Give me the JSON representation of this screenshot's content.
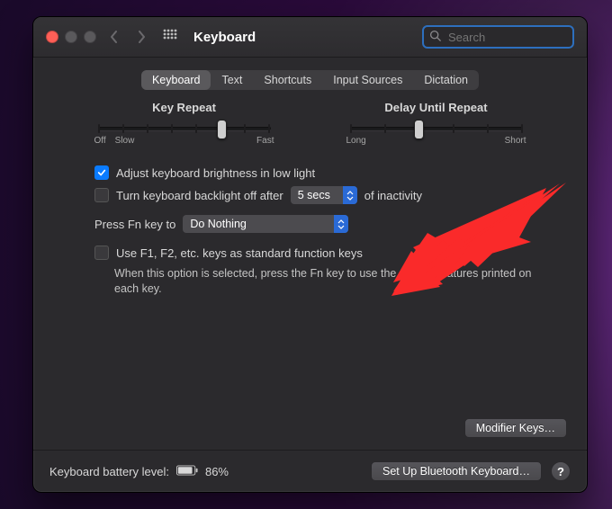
{
  "header": {
    "title": "Keyboard",
    "search_placeholder": "Search"
  },
  "tabs": [
    {
      "label": "Keyboard",
      "selected": true
    },
    {
      "label": "Text",
      "selected": false
    },
    {
      "label": "Shortcuts",
      "selected": false
    },
    {
      "label": "Input Sources",
      "selected": false
    },
    {
      "label": "Dictation",
      "selected": false
    }
  ],
  "sliders": {
    "key_repeat": {
      "label": "Key Repeat",
      "ticks": 8,
      "value_index": 5,
      "left_labels": [
        "Off",
        "Slow"
      ],
      "right_label": "Fast"
    },
    "delay_until_repeat": {
      "label": "Delay Until Repeat",
      "ticks": 6,
      "value_index": 2,
      "left_label": "Long",
      "right_label": "Short"
    }
  },
  "options": {
    "adjust_brightness": {
      "label": "Adjust keyboard brightness in low light",
      "checked": true
    },
    "turn_off_backlight": {
      "label_before": "Turn keyboard backlight off after",
      "label_after": "of inactivity",
      "checked": false,
      "value": "5 secs"
    },
    "press_fn": {
      "label": "Press Fn key to",
      "value": "Do Nothing"
    },
    "use_fkeys": {
      "label": "Use F1, F2, etc. keys as standard function keys",
      "checked": false,
      "description": "When this option is selected, press the Fn key to use the special features printed on each key."
    }
  },
  "buttons": {
    "modifier_keys": "Modifier Keys…",
    "bluetooth": "Set Up Bluetooth Keyboard…"
  },
  "footer": {
    "battery_label": "Keyboard battery level:",
    "battery_percent": "86%"
  }
}
